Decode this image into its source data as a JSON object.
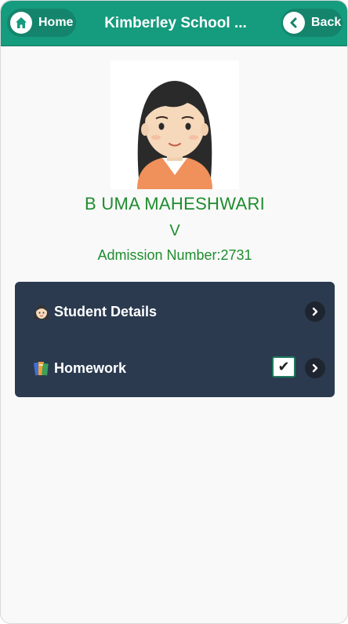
{
  "header": {
    "home_label": "Home",
    "title": "Kimberley School ...",
    "back_label": "Back"
  },
  "student": {
    "name": "B UMA MAHESHWARI",
    "class": "V",
    "admission": "Admission Number:2731"
  },
  "menu": {
    "items": [
      {
        "label": "Student Details",
        "icon": "student-emoji-icon"
      },
      {
        "label": "Homework",
        "icon": "books-emoji-icon",
        "checked": true
      }
    ],
    "checkbox_glyph": "✔"
  },
  "colors": {
    "header_bg": "#159b7d",
    "accent_text": "#1f8c2e",
    "menu_bg": "#2b3a4f"
  }
}
